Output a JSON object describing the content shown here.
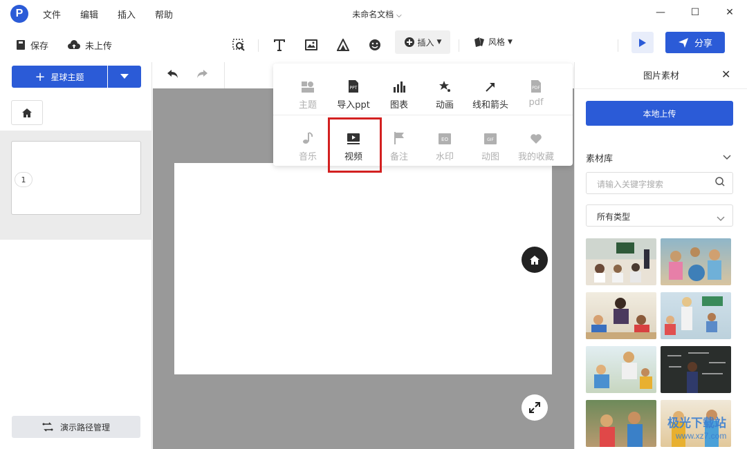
{
  "app": {
    "logo_letter": "P",
    "doc_title": "未命名文档"
  },
  "menu": {
    "file": "文件",
    "edit": "编辑",
    "insert": "插入",
    "help": "帮助"
  },
  "window_controls": {
    "min": "—",
    "max": "☐",
    "close": "✕"
  },
  "toolbar": {
    "save": "保存",
    "upload_status": "未上传",
    "insert": "插入",
    "style": "风格",
    "share": "分享"
  },
  "left_panel": {
    "theme_button": "星球主题",
    "slide_number": "1",
    "path_manage": "演示路径管理"
  },
  "insert_menu": {
    "row1": [
      {
        "label": "主题",
        "icon": "theme-icon",
        "enabled": false
      },
      {
        "label": "导入ppt",
        "icon": "ppt-icon",
        "enabled": true
      },
      {
        "label": "图表",
        "icon": "chart-icon",
        "enabled": true
      },
      {
        "label": "动画",
        "icon": "animation-icon",
        "enabled": true
      },
      {
        "label": "线和箭头",
        "icon": "arrow-icon",
        "enabled": true
      },
      {
        "label": "pdf",
        "icon": "pdf-icon",
        "enabled": false
      }
    ],
    "row2": [
      {
        "label": "音乐",
        "icon": "music-icon",
        "enabled": false
      },
      {
        "label": "视频",
        "icon": "video-icon",
        "enabled": true
      },
      {
        "label": "备注",
        "icon": "flag-icon",
        "enabled": false
      },
      {
        "label": "水印",
        "icon": "watermark-icon",
        "enabled": false
      },
      {
        "label": "动图",
        "icon": "gif-icon",
        "enabled": false
      },
      {
        "label": "我的收藏",
        "icon": "heart-icon",
        "enabled": false
      }
    ],
    "icon_text": {
      "ppt": "PPT",
      "pdf": "PDF",
      "watermark": "EO",
      "gif": "GIF"
    }
  },
  "right_panel": {
    "title": "图片素材",
    "close": "✕",
    "upload_button": "本地上传",
    "library_label": "素材库",
    "search_placeholder": "请输入关键字搜索",
    "type_select": "所有类型"
  },
  "watermark": {
    "text": "极光下载站",
    "url": "www.xz7.com"
  },
  "colors": {
    "accent": "#2b5bd7",
    "highlight": "#d32020",
    "canvas": "#999999"
  }
}
